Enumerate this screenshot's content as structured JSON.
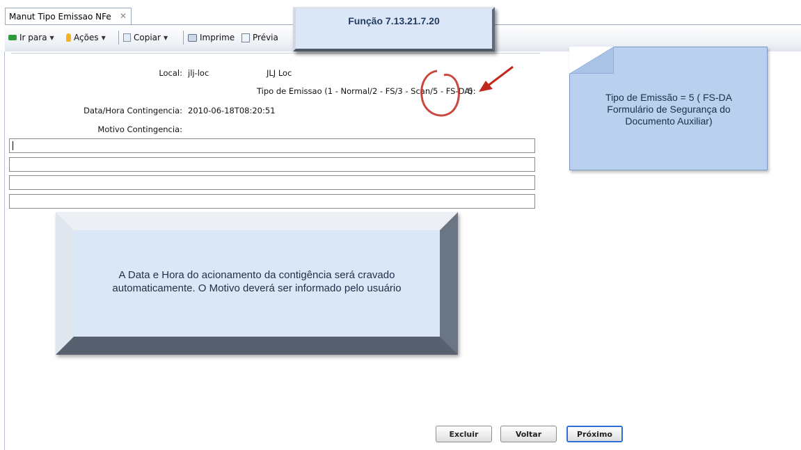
{
  "tab": {
    "title": "Manut Tipo Emissao NFe",
    "close": "✕"
  },
  "toolbar": {
    "ir_para": "Ir para",
    "acoes": "Ações",
    "copiar": "Copiar",
    "imprime": "Imprime",
    "previa": "Prévia",
    "caret": "▼"
  },
  "function_callout": "Função 7.13.21.7.20",
  "form": {
    "local_label": "Local:",
    "local_code": "jlj-loc",
    "local_name": "JLJ Loc",
    "tipo_label": "Tipo de Emissao (1 - Normal/2 - FS/3 - Scan/5 - FS-DA):",
    "tipo_value": "5",
    "data_label": "Data/Hora Contingencia:",
    "data_value": "2010-06-18T08:20:51",
    "motivo_label": "Motivo Contingencia:",
    "motivo_lines": [
      "",
      "",
      "",
      ""
    ]
  },
  "note": {
    "line1": "Tipo de Emissão = 5 ( FS-DA",
    "line2": "Formulário de Segurança do",
    "line3": "Documento Auxiliar)"
  },
  "big_callout": {
    "line1": "A Data e Hora do acionamento da contigência será cravado",
    "line2": "automaticamente. O Motivo deverá ser informado pelo usuário"
  },
  "buttons": {
    "excluir": "Excluir",
    "voltar": "Voltar",
    "proximo": "Próximo"
  },
  "colors": {
    "annotation_red": "#c0281e",
    "note_fill": "#b9d1ee",
    "primary_border": "#2a6fd1"
  }
}
